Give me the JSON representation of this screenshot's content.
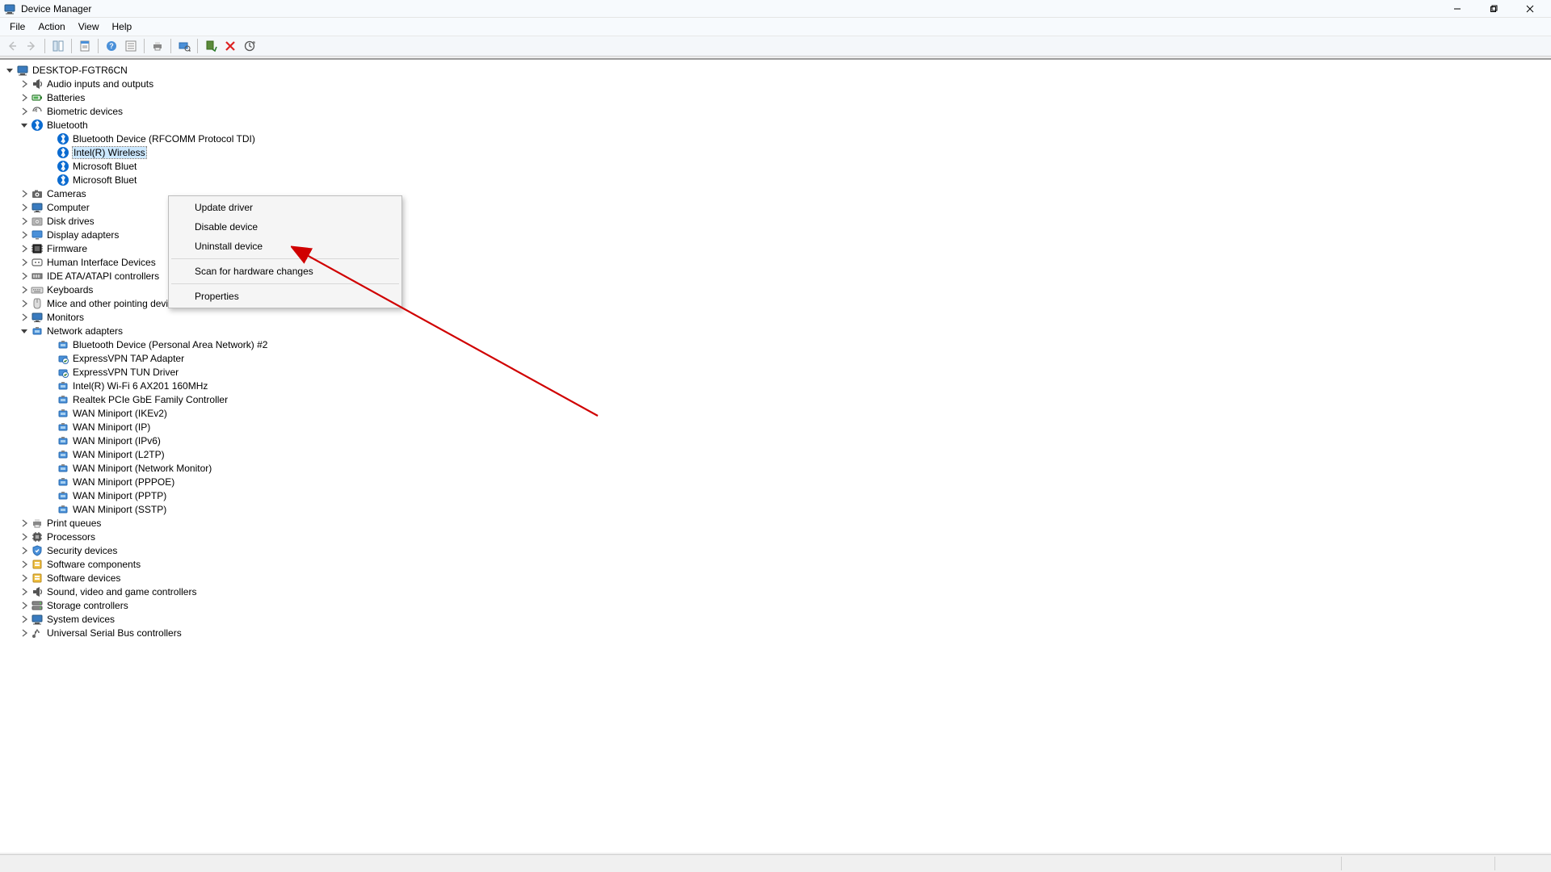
{
  "window": {
    "title": "Device Manager"
  },
  "menubar": {
    "file": "File",
    "action": "Action",
    "view": "View",
    "help": "Help"
  },
  "tree": {
    "root": "DESKTOP-FGTR6CN",
    "categories": {
      "audio": "Audio inputs and outputs",
      "batteries": "Batteries",
      "biometric": "Biometric devices",
      "bluetooth": "Bluetooth",
      "cameras": "Cameras",
      "computer": "Computer",
      "diskdrives": "Disk drives",
      "displayadapters": "Display adapters",
      "firmware": "Firmware",
      "hid": "Human Interface Devices",
      "ide": "IDE ATA/ATAPI controllers",
      "keyboards": "Keyboards",
      "mice": "Mice and other pointing devices",
      "monitors": "Monitors",
      "network": "Network adapters",
      "printqueues": "Print queues",
      "processors": "Processors",
      "security": "Security devices",
      "swcomp": "Software components",
      "swdev": "Software devices",
      "sound": "Sound, video and game controllers",
      "storage": "Storage controllers",
      "sysdev": "System devices",
      "usb": "Universal Serial Bus controllers"
    },
    "bluetooth_children": {
      "c0": "Bluetooth Device (RFCOMM Protocol TDI)",
      "c1": "Intel(R) Wireless",
      "c2": "Microsoft Bluet",
      "c3": "Microsoft Bluet"
    },
    "network_children": {
      "n0": "Bluetooth Device (Personal Area Network) #2",
      "n1": "ExpressVPN TAP Adapter",
      "n2": "ExpressVPN TUN Driver",
      "n3": "Intel(R) Wi-Fi 6 AX201 160MHz",
      "n4": "Realtek PCIe GbE Family Controller",
      "n5": "WAN Miniport (IKEv2)",
      "n6": "WAN Miniport (IP)",
      "n7": "WAN Miniport (IPv6)",
      "n8": "WAN Miniport (L2TP)",
      "n9": "WAN Miniport (Network Monitor)",
      "n10": "WAN Miniport (PPPOE)",
      "n11": "WAN Miniport (PPTP)",
      "n12": "WAN Miniport (SSTP)"
    }
  },
  "context_menu": {
    "update": "Update driver",
    "disable": "Disable device",
    "uninstall": "Uninstall device",
    "scan": "Scan for hardware changes",
    "properties": "Properties"
  }
}
